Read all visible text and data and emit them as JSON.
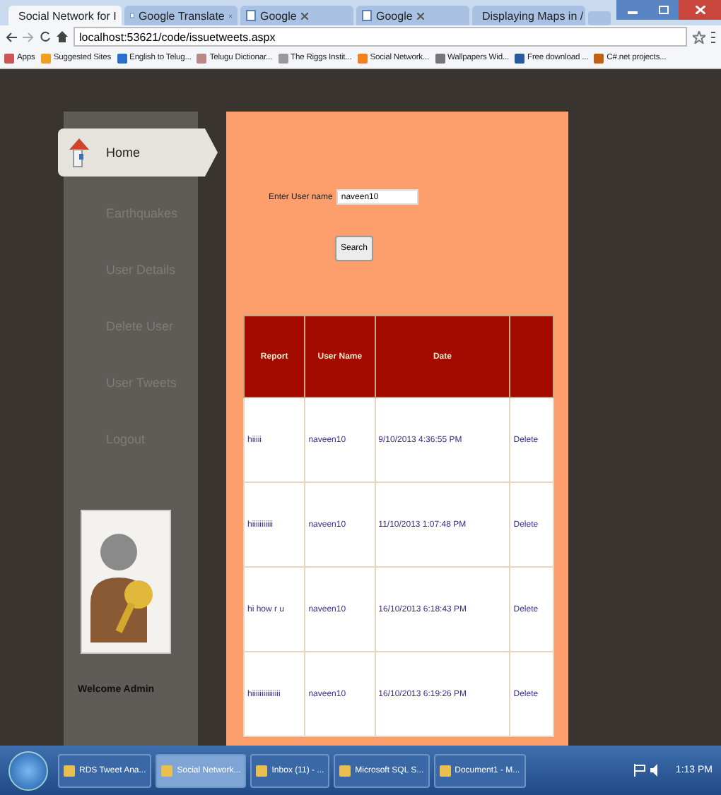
{
  "browser": {
    "tabs": [
      {
        "label": "Social Network for I",
        "selected": true
      },
      {
        "label": "Google Translate",
        "selected": false
      },
      {
        "label": "Google",
        "selected": false
      },
      {
        "label": "Google",
        "selected": false
      },
      {
        "label": "Displaying Maps in /",
        "selected": false
      }
    ],
    "address": "localhost:53621/code/issuetweets.aspx",
    "bookmarks": [
      "Apps",
      "Suggested Sites",
      "English to Telug...",
      "Telugu Dictionar...",
      "The Riggs Instit...",
      "Social Network...",
      "Wallpapers Wid...",
      "Free download ...",
      "C#.net projects..."
    ]
  },
  "sidebar": {
    "items": [
      {
        "label": "Home",
        "selected": true
      },
      {
        "label": "Earthquakes",
        "selected": false
      },
      {
        "label": "User Details",
        "selected": false
      },
      {
        "label": "Delete User",
        "selected": false
      },
      {
        "label": "User Tweets",
        "selected": false
      },
      {
        "label": "Logout",
        "selected": false
      }
    ],
    "welcome": "Welcome Admin"
  },
  "search": {
    "label": "Enter User name",
    "value": "naveen10",
    "button": "Search"
  },
  "table": {
    "columns": [
      "Report",
      "User Name",
      "Date"
    ],
    "rows": [
      [
        "hiiiii",
        "naveen10",
        "9/10/2013 4:36:55 PM",
        "Delete"
      ],
      [
        "hiiiiiiiiiii",
        "naveen10",
        "11/10/2013 1:07:48 PM",
        "Delete"
      ],
      [
        "hi how r u",
        "naveen10",
        "16/10/2013 6:18:43 PM",
        "Delete"
      ],
      [
        "hiiiiiiiiiiiiiii",
        "naveen10",
        "16/10/2013 6:19:26 PM",
        "Delete"
      ]
    ]
  },
  "taskbar": {
    "items": [
      {
        "label": "RDS Tweet Ana...",
        "selected": false
      },
      {
        "label": "Social Network...",
        "selected": true
      },
      {
        "label": "Inbox (11) - ...",
        "selected": false
      },
      {
        "label": "Microsoft SQL S...",
        "selected": false
      },
      {
        "label": "Document1 - M...",
        "selected": false
      }
    ],
    "clock": "1:13 PM"
  }
}
